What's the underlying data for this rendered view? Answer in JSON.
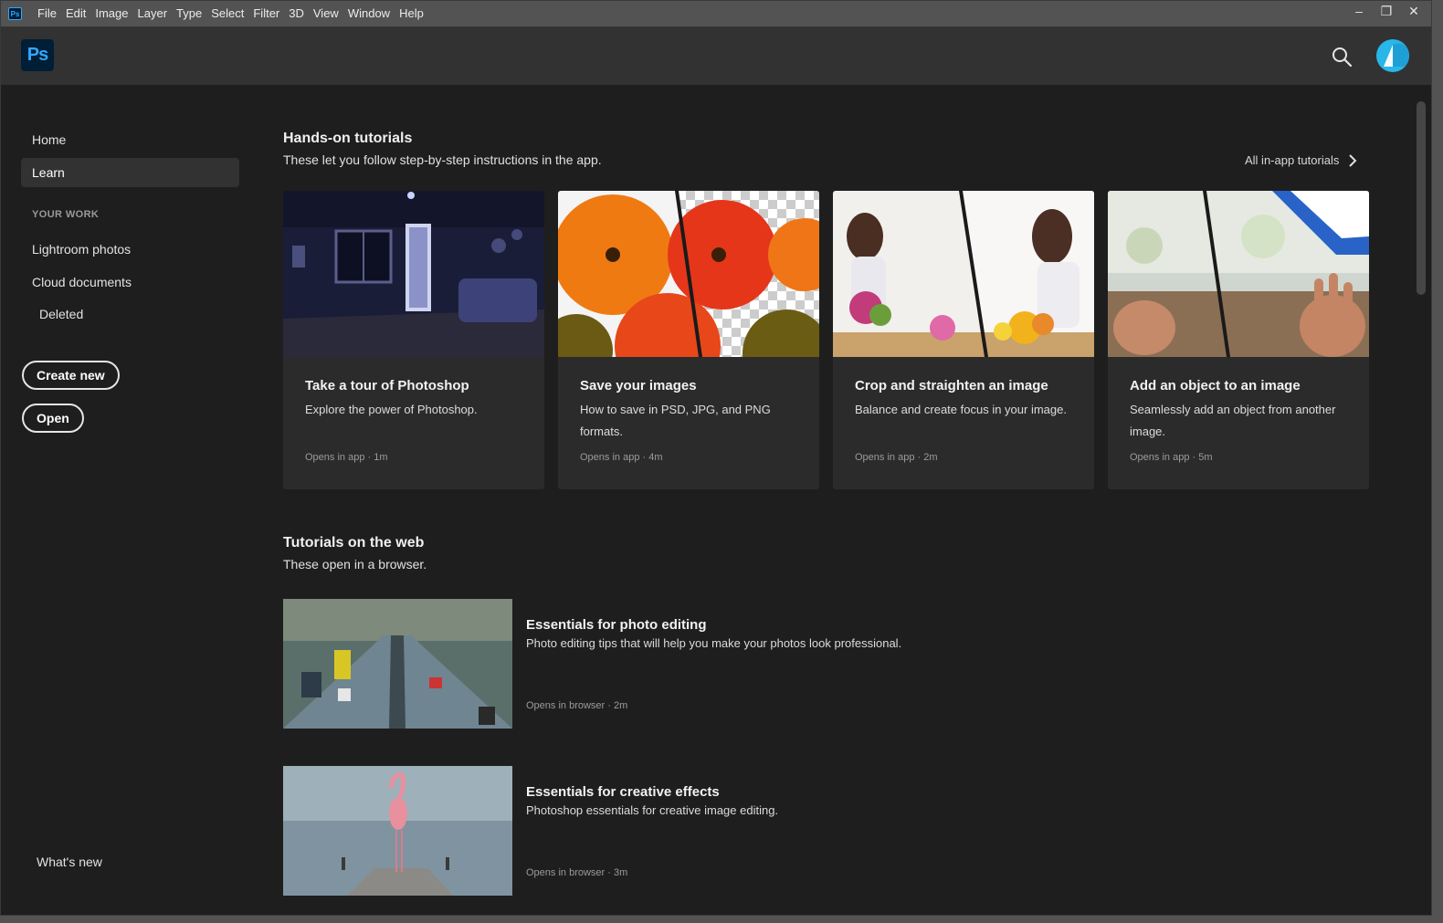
{
  "menubar": {
    "app_badge": "Ps",
    "items": [
      "File",
      "Edit",
      "Image",
      "Layer",
      "Type",
      "Select",
      "Filter",
      "3D",
      "View",
      "Window",
      "Help"
    ],
    "controls": [
      "–",
      "❐",
      "✕"
    ]
  },
  "header": {
    "logo": "Ps"
  },
  "sidebar": {
    "home": "Home",
    "learn": "Learn",
    "your_work": "YOUR WORK",
    "lightroom": "Lightroom photos",
    "cloud": "Cloud documents",
    "deleted": "Deleted",
    "create_new": "Create new",
    "open": "Open",
    "whats_new": "What's new"
  },
  "hands_on": {
    "title": "Hands-on tutorials",
    "subtitle": "These let you follow step-by-step instructions in the app.",
    "all_link": "All in-app tutorials",
    "cards": [
      {
        "title": "Take a tour of Photoshop",
        "desc": "Explore the power of Photoshop.",
        "meta": "Opens in app  ·  1m"
      },
      {
        "title": "Save your images",
        "desc": "How to save in PSD, JPG, and PNG formats.",
        "meta": "Opens in app  ·  4m"
      },
      {
        "title": "Crop and straighten an image",
        "desc": "Balance and create focus in your image.",
        "meta": "Opens in app  ·  2m"
      },
      {
        "title": "Add an object to an image",
        "desc": "Seamlessly add an object from another image.",
        "meta": "Opens in app  ·  5m"
      }
    ]
  },
  "web": {
    "title": "Tutorials on the web",
    "subtitle": "These open in a browser.",
    "items": [
      {
        "title": "Essentials for photo editing",
        "desc": "Photo editing tips that will help you make your photos look professional.",
        "meta": "Opens in browser  ·  2m"
      },
      {
        "title": "Essentials for creative effects",
        "desc": "Photoshop essentials for creative image editing.",
        "meta": "Opens in browser  ·  3m"
      }
    ]
  },
  "colors": {
    "app_bg": "#1e1e1e",
    "header_bg": "#323232",
    "card_bg": "#2b2b2b",
    "accent": "#31a8ff",
    "avatar": "#29b6e8"
  }
}
